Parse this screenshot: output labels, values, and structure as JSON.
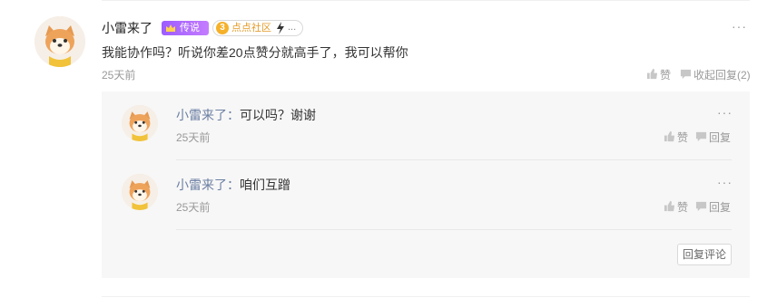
{
  "comment": {
    "author": "小雷来了",
    "badge_legend": "传说",
    "badge_community": {
      "level": "3",
      "label": "点点社区",
      "suffix": "..."
    },
    "content": "我能协作吗？听说你差20点赞分就高手了，我可以帮你",
    "time": "25天前",
    "like_label": "赞",
    "collapse_label": "收起回复(2)",
    "more": "···"
  },
  "replies": [
    {
      "author": "小雷来了",
      "separator": "：",
      "text": "可以吗？谢谢",
      "time": "25天前",
      "like_label": "赞",
      "reply_label": "回复",
      "more": "···"
    },
    {
      "author": "小雷来了",
      "separator": "：",
      "text": "咱们互蹭",
      "time": "25天前",
      "like_label": "赞",
      "reply_label": "回复",
      "more": "···"
    }
  ],
  "reply_comment_button": "回复评论",
  "colors": {
    "legend_badge": "#a865ff",
    "link_name": "#6b7fa3",
    "reply_bg": "#f7f7f7"
  },
  "icons": [
    "shiba-avatar",
    "crown-icon",
    "coin-icon",
    "bolt-icon",
    "thumb-up-icon",
    "comment-icon",
    "more-icon"
  ]
}
